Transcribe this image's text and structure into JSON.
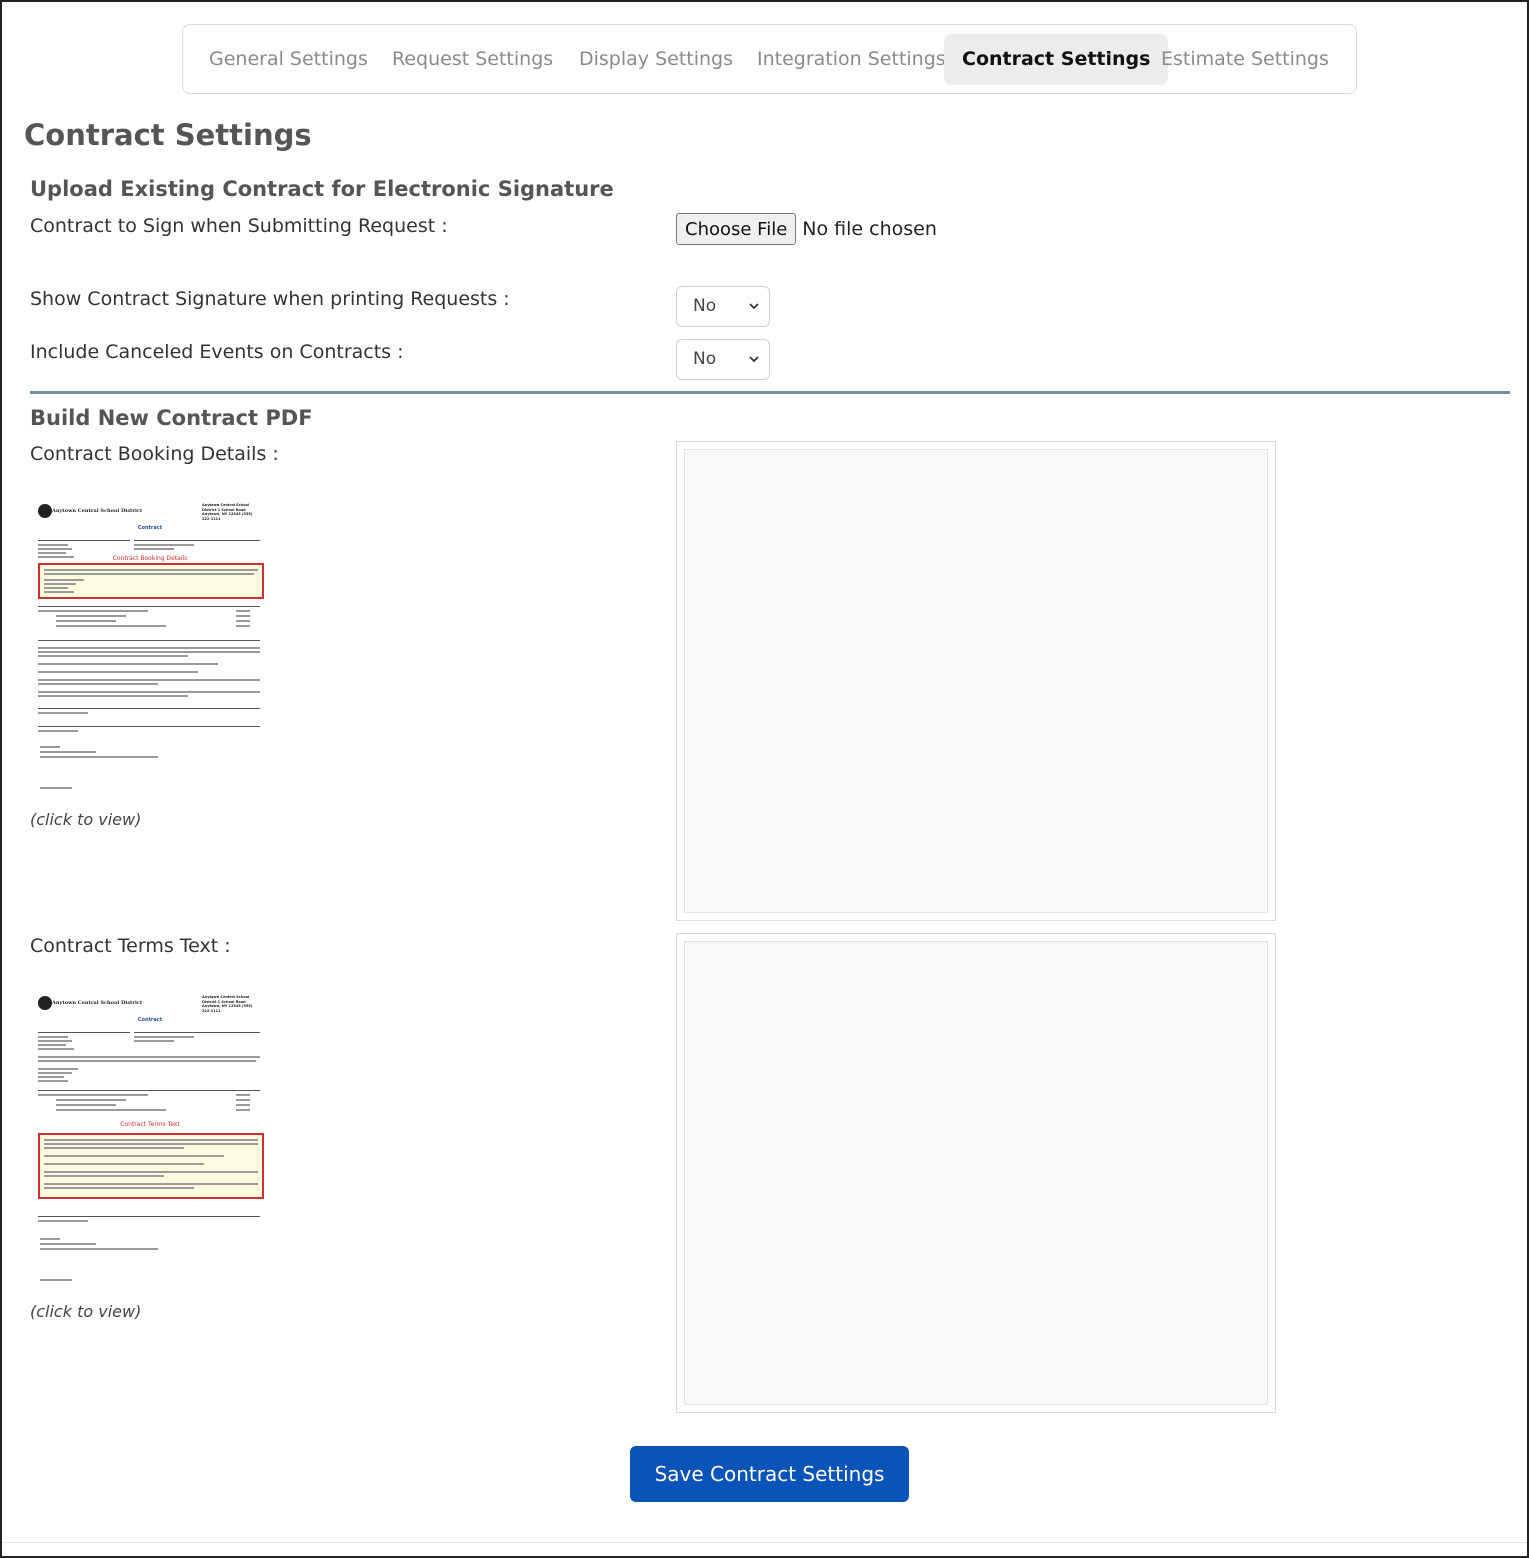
{
  "tabs": [
    {
      "label": "General Settings",
      "active": false
    },
    {
      "label": "Request Settings",
      "active": false
    },
    {
      "label": "Display Settings",
      "active": false
    },
    {
      "label": "Integration Settings",
      "active": false
    },
    {
      "label": "Contract Settings",
      "active": true
    },
    {
      "label": "Estimate Settings",
      "active": false
    }
  ],
  "page_title": "Contract Settings",
  "upload_section": {
    "title": "Upload Existing Contract for Electronic Signature",
    "contract_to_sign_label": "Contract to Sign when Submitting Request :",
    "file_button_label": "Choose File",
    "file_status": "No file chosen",
    "show_signature_label": "Show Contract Signature when printing Requests :",
    "show_signature_value": "No",
    "include_canceled_label": "Include Canceled Events on Contracts :",
    "include_canceled_value": "No"
  },
  "build_section": {
    "title": "Build New Contract PDF",
    "booking_details_label": "Contract Booking Details :",
    "booking_thumb_highlight": "Contract Booking Details",
    "terms_text_label": "Contract Terms Text :",
    "terms_thumb_highlight": "Contract Terms Text",
    "click_to_view": "(click to view)"
  },
  "thumbnail": {
    "district": "Anytown Central School District",
    "address": "Anytown Central School District 1 School Road Anytown, NY 12345 (555) 222-1111",
    "heading": "Contract"
  },
  "save_button_label": "Save Contract Settings",
  "colors": {
    "accent": "#0a53b8",
    "divider": "#6a8fa8",
    "highlight_border": "#d32f2f",
    "highlight_fill": "#fbfbe0"
  }
}
